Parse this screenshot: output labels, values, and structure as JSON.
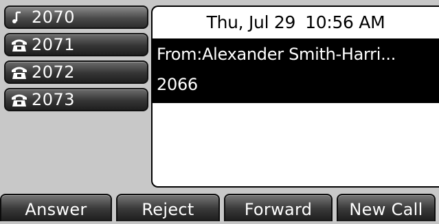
{
  "lines": [
    {
      "number": "2070",
      "icon": "line-indicator-icon",
      "active": true
    },
    {
      "number": "2071",
      "icon": "phone-handset-icon"
    },
    {
      "number": "2072",
      "icon": "phone-handset-icon"
    },
    {
      "number": "2073",
      "icon": "phone-handset-icon"
    }
  ],
  "status": {
    "date": "Thu, Jul 29",
    "time": "10:56 AM"
  },
  "incoming_call": {
    "from": "From:Alexander Smith-Harri...",
    "number": "2066"
  },
  "softkeys": {
    "answer": "Answer",
    "reject": "Reject",
    "forward": "Forward",
    "new_call": "New Call"
  }
}
